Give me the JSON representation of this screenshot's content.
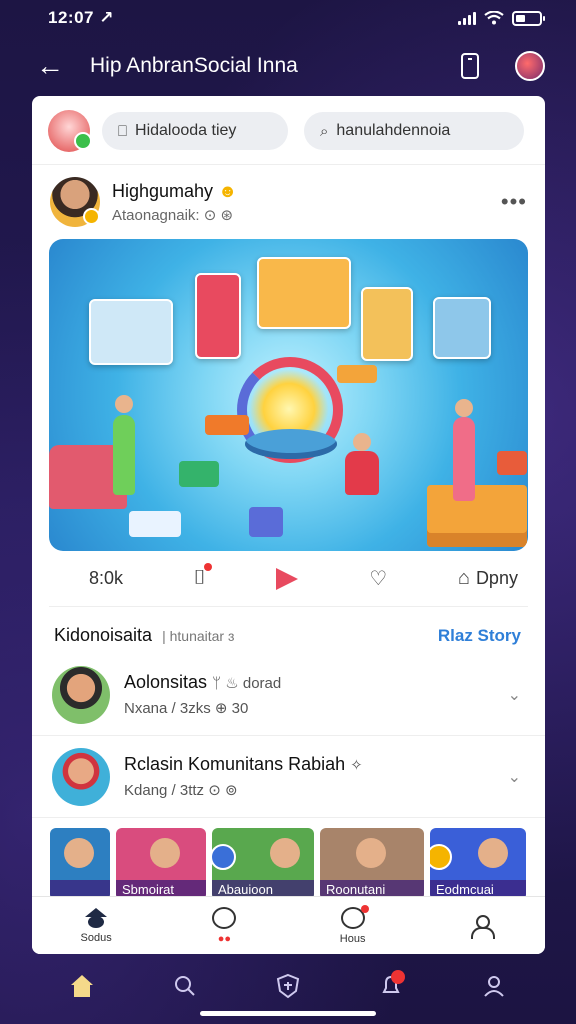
{
  "status_bar": {
    "time": "12:07 ↗"
  },
  "header": {
    "title": "Hip AnbranSocial Inna"
  },
  "top_row": {
    "pill_left": "Hidalooda tiey",
    "pill_right": "hanulahdennoia"
  },
  "post": {
    "author": "Highgumahy",
    "subtitle": "Ataonagnaik: ⊙ ⊛",
    "more": "•••"
  },
  "actions": {
    "count": "8:0k",
    "share_label": "Dpny"
  },
  "section": {
    "title": "Kidonoisaita",
    "subtitle": "| htunaitar ɜ",
    "link": "Rlaz Story"
  },
  "communities": [
    {
      "name": "Aolonsitas",
      "tag": "ᛘ ♨ dorad",
      "meta": "Nxana / 3zks ⊕ 30"
    },
    {
      "name": "Rclasin Komunitans Rabiah",
      "tag": "✧",
      "meta": "Kdang / 3ttz ⊙ ⊚"
    }
  ],
  "thumbnails": [
    {
      "caption": "",
      "color": "#2d7fc1"
    },
    {
      "caption": "Sbmoirat",
      "color": "#d94c7e"
    },
    {
      "caption": "Abauioon",
      "color": "#59a84e"
    },
    {
      "caption": "Roonutani",
      "color": "#a8846a"
    },
    {
      "caption": "Eodmcuai",
      "color": "#3a5fd8"
    }
  ],
  "card_tabs": {
    "home_label": "Sodus",
    "msg_label": "●●",
    "notif_label": "Hous"
  },
  "colors": {
    "background": "#1e1647",
    "accent_link": "#2f7fd8",
    "badge_red": "#e33"
  }
}
